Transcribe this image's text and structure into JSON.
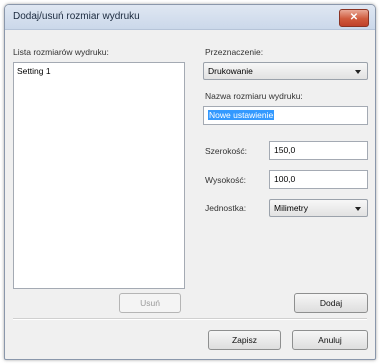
{
  "window": {
    "title": "Dodaj/usuń rozmiar wydruku",
    "close_glyph": "✕"
  },
  "list": {
    "label": "Lista rozmiarów wydruku:",
    "items": [
      "Setting 1"
    ]
  },
  "destination": {
    "label": "Przeznaczenie:",
    "selected": "Drukowanie"
  },
  "size_name": {
    "label": "Nazwa rozmiaru wydruku:",
    "value": "Nowe ustawienie"
  },
  "width": {
    "label": "Szerokość:",
    "value": "150,0"
  },
  "height": {
    "label": "Wysokość:",
    "value": "100,0"
  },
  "unit": {
    "label": "Jednostka:",
    "selected": "Milimetry"
  },
  "buttons": {
    "delete": "Usuń",
    "add": "Dodaj",
    "save": "Zapisz",
    "cancel": "Anuluj"
  },
  "colors": {
    "selection": "#3399ff",
    "close_button": "#cf5a3c"
  }
}
